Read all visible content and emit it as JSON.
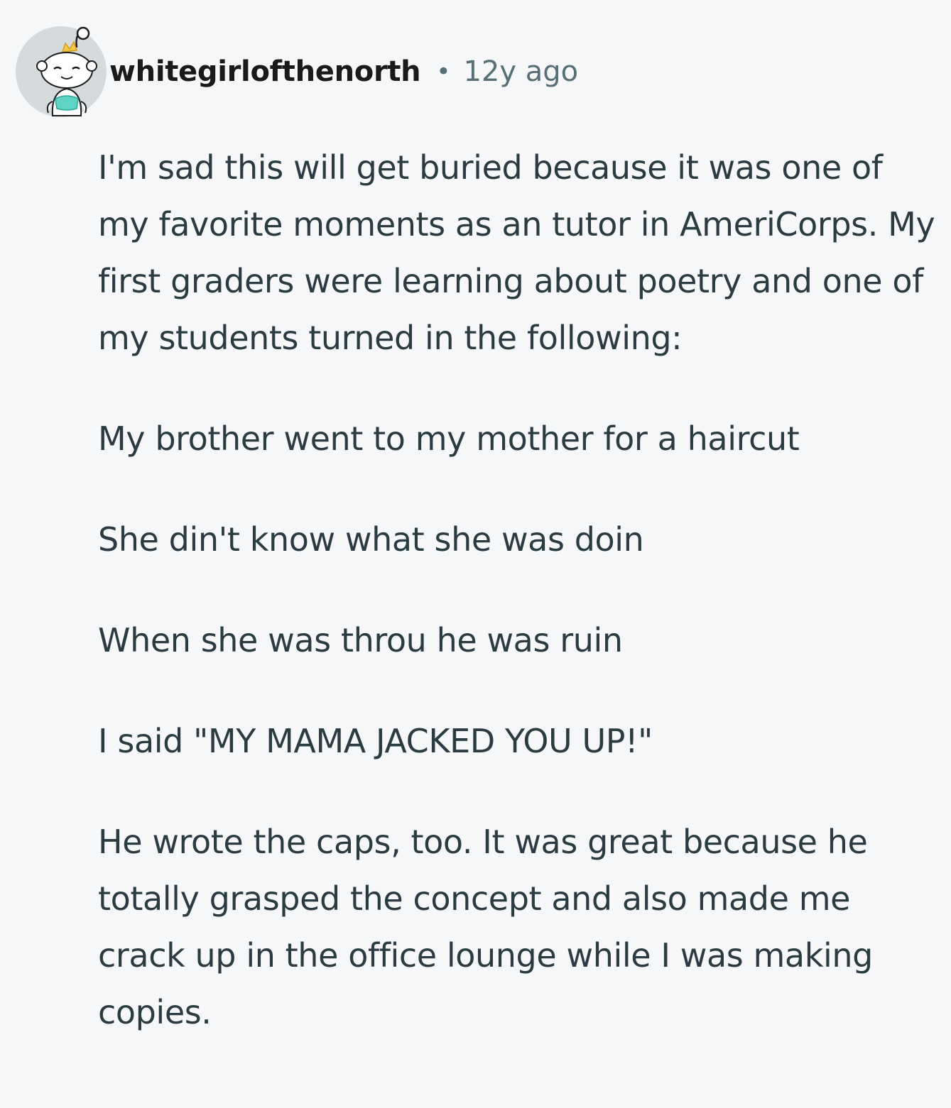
{
  "comment": {
    "author": "whitegirlofthenorth",
    "separator": "•",
    "timestamp": "12y ago",
    "avatar_icon": "snoo-avatar-icon",
    "paragraphs": [
      "I'm sad this will get buried because it was one of my favorite moments as an tutor in AmeriCorps. My first graders were learning about poetry and one of my students turned in the following:",
      "My brother went to my mother for a haircut",
      "She din't know what she was doin",
      "When she was throu he was ruin",
      "I said \"MY MAMA JACKED YOU UP!\"",
      "He wrote the caps, too. It was great because he totally grasped the concept and also made me crack up in the office lounge while I was making copies."
    ]
  },
  "colors": {
    "background": "#f6f7f8",
    "author_text": "#1a1a1b",
    "meta_text": "#576f76",
    "body_text": "#2a3c42"
  }
}
